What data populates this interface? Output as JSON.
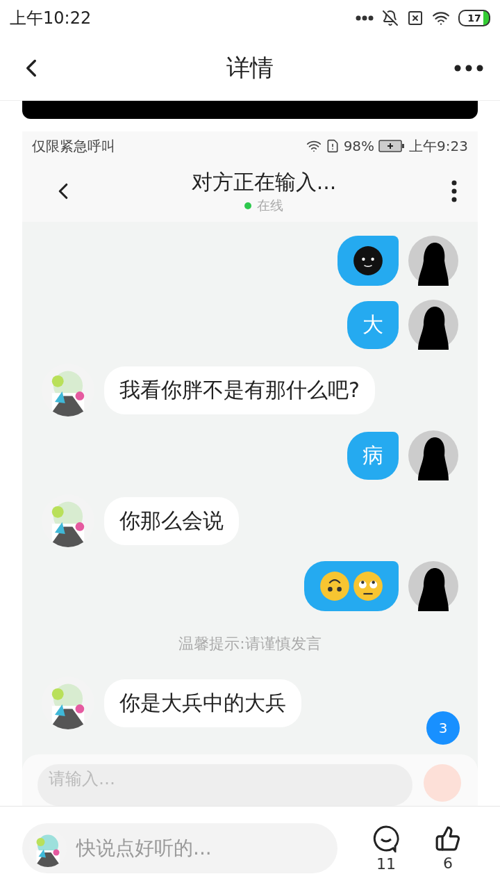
{
  "status_bar": {
    "time": "上午10:22",
    "battery": "17"
  },
  "header": {
    "title": "详情"
  },
  "inner_status_bar": {
    "carrier": "仅限紧急呼叫",
    "battery": "98%",
    "time": "上午9:23"
  },
  "chat_header": {
    "title": "对方正在输入...",
    "status": "在线",
    "online": true
  },
  "messages": [
    {
      "kind": "sticker",
      "outgoing": true
    },
    {
      "kind": "text",
      "outgoing": true,
      "text": "大"
    },
    {
      "kind": "text",
      "outgoing": false,
      "text": "我看你胖不是有那什么吧?"
    },
    {
      "kind": "text",
      "outgoing": true,
      "text": "病"
    },
    {
      "kind": "text",
      "outgoing": false,
      "text": "你那么会说"
    },
    {
      "kind": "emojis",
      "outgoing": true
    },
    {
      "kind": "notice",
      "text": "温馨提示:请谨慎发言"
    },
    {
      "kind": "text",
      "outgoing": false,
      "text": "你是大兵中的大兵"
    }
  ],
  "unread_badge": "3",
  "chat_input": {
    "placeholder": "请输入…"
  },
  "bottom_bar": {
    "placeholder": "快说点好听的...",
    "comments": "11",
    "likes": "6"
  }
}
